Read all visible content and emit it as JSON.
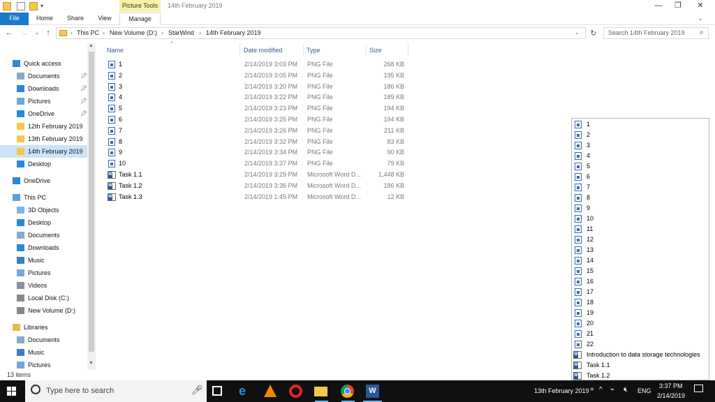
{
  "titlebar": {
    "contextual_tab": "Picture Tools",
    "window_title": "14th February 2019",
    "minimize": "—",
    "restore": "❐",
    "close": "✕"
  },
  "ribbon": {
    "tabs": [
      "File",
      "Home",
      "Share",
      "View",
      "Manage"
    ]
  },
  "address": {
    "crumbs": [
      "This PC",
      "New Volume (D:)",
      "StarWind",
      "14th February 2019"
    ],
    "search_placeholder": "Search 14th February 2019"
  },
  "nav": {
    "items": [
      {
        "label": "Quick access",
        "icon": "star-icon"
      },
      {
        "label": "Documents",
        "icon": "documents-icon",
        "pinned": true
      },
      {
        "label": "Downloads",
        "icon": "download-icon",
        "pinned": true
      },
      {
        "label": "Pictures",
        "icon": "pictures-icon",
        "pinned": true
      },
      {
        "label": "OneDrive",
        "icon": "cloud-icon",
        "pinned": true
      },
      {
        "label": "12th February 2019",
        "icon": "folder-icon"
      },
      {
        "label": "13th February 2019",
        "icon": "folder-icon"
      },
      {
        "label": "14th February 2019",
        "icon": "folder-icon",
        "selected": true
      },
      {
        "label": "Desktop",
        "icon": "desktop-icon"
      },
      {
        "label": "OneDrive",
        "icon": "cloud-icon"
      },
      {
        "label": "This PC",
        "icon": "computer-icon"
      },
      {
        "label": "3D Objects",
        "icon": "cube-icon"
      },
      {
        "label": "Desktop",
        "icon": "desktop-icon"
      },
      {
        "label": "Documents",
        "icon": "documents-icon"
      },
      {
        "label": "Downloads",
        "icon": "download-icon"
      },
      {
        "label": "Music",
        "icon": "music-icon"
      },
      {
        "label": "Pictures",
        "icon": "pictures-icon"
      },
      {
        "label": "Videos",
        "icon": "videos-icon"
      },
      {
        "label": "Local Disk (C:)",
        "icon": "drive-icon"
      },
      {
        "label": "New Volume (D:)",
        "icon": "drive-icon"
      },
      {
        "label": "Libraries",
        "icon": "library-icon"
      },
      {
        "label": "Documents",
        "icon": "documents-icon"
      },
      {
        "label": "Music",
        "icon": "music-icon"
      },
      {
        "label": "Pictures",
        "icon": "pictures-icon"
      }
    ]
  },
  "list": {
    "columns": [
      "Name",
      "Date modified",
      "Type",
      "Size"
    ],
    "rows": [
      {
        "name": "1",
        "date": "2/14/2019 3:03 PM",
        "type": "PNG File",
        "size": "268 KB",
        "kind": "png"
      },
      {
        "name": "2",
        "date": "2/14/2019 3:05 PM",
        "type": "PNG File",
        "size": "195 KB",
        "kind": "png"
      },
      {
        "name": "3",
        "date": "2/14/2019 3:20 PM",
        "type": "PNG File",
        "size": "186 KB",
        "kind": "png"
      },
      {
        "name": "4",
        "date": "2/14/2019 3:22 PM",
        "type": "PNG File",
        "size": "189 KB",
        "kind": "png"
      },
      {
        "name": "5",
        "date": "2/14/2019 3:23 PM",
        "type": "PNG File",
        "size": "194 KB",
        "kind": "png"
      },
      {
        "name": "6",
        "date": "2/14/2019 3:25 PM",
        "type": "PNG File",
        "size": "194 KB",
        "kind": "png"
      },
      {
        "name": "7",
        "date": "2/14/2019 3:26 PM",
        "type": "PNG File",
        "size": "211 KB",
        "kind": "png"
      },
      {
        "name": "8",
        "date": "2/14/2019 3:32 PM",
        "type": "PNG File",
        "size": "83 KB",
        "kind": "png"
      },
      {
        "name": "9",
        "date": "2/14/2019 3:34 PM",
        "type": "PNG File",
        "size": "90 KB",
        "kind": "png"
      },
      {
        "name": "10",
        "date": "2/14/2019 3:37 PM",
        "type": "PNG File",
        "size": "79 KB",
        "kind": "png"
      },
      {
        "name": "Task 1.1",
        "date": "2/14/2019 3:29 PM",
        "type": "Microsoft Word D...",
        "size": "1,448 KB",
        "kind": "word"
      },
      {
        "name": "Task 1.2",
        "date": "2/14/2019 3:36 PM",
        "type": "Microsoft Word D...",
        "size": "186 KB",
        "kind": "word"
      },
      {
        "name": "Task 1.3",
        "date": "2/14/2019 1:45 PM",
        "type": "Microsoft Word D...",
        "size": "12 KB",
        "kind": "word"
      }
    ]
  },
  "popup": {
    "items": [
      {
        "label": "1",
        "kind": "png"
      },
      {
        "label": "2",
        "kind": "png"
      },
      {
        "label": "3",
        "kind": "png"
      },
      {
        "label": "4",
        "kind": "png"
      },
      {
        "label": "5",
        "kind": "png"
      },
      {
        "label": "6",
        "kind": "png"
      },
      {
        "label": "7",
        "kind": "png"
      },
      {
        "label": "8",
        "kind": "png"
      },
      {
        "label": "9",
        "kind": "png"
      },
      {
        "label": "10",
        "kind": "png"
      },
      {
        "label": "11",
        "kind": "png"
      },
      {
        "label": "12",
        "kind": "png"
      },
      {
        "label": "13",
        "kind": "png"
      },
      {
        "label": "14",
        "kind": "png"
      },
      {
        "label": "15",
        "kind": "png"
      },
      {
        "label": "16",
        "kind": "png"
      },
      {
        "label": "17",
        "kind": "png"
      },
      {
        "label": "18",
        "kind": "png"
      },
      {
        "label": "19",
        "kind": "png"
      },
      {
        "label": "20",
        "kind": "png"
      },
      {
        "label": "21",
        "kind": "png"
      },
      {
        "label": "22",
        "kind": "png"
      },
      {
        "label": "Introduction to data storage technologies",
        "kind": "word"
      },
      {
        "label": "Task 1.1",
        "kind": "word"
      },
      {
        "label": "Task 1.2",
        "kind": "word"
      }
    ]
  },
  "status": {
    "items_count": "13 items"
  },
  "taskbar": {
    "search_placeholder": "Type here to search",
    "toolbar_label": "13th February 2019",
    "language": "ENG",
    "time": "3:37 PM",
    "date": "2/14/2019"
  },
  "colors": {
    "accent": "#1979ca",
    "selection": "#cce4f7",
    "taskbar": "#101010"
  }
}
